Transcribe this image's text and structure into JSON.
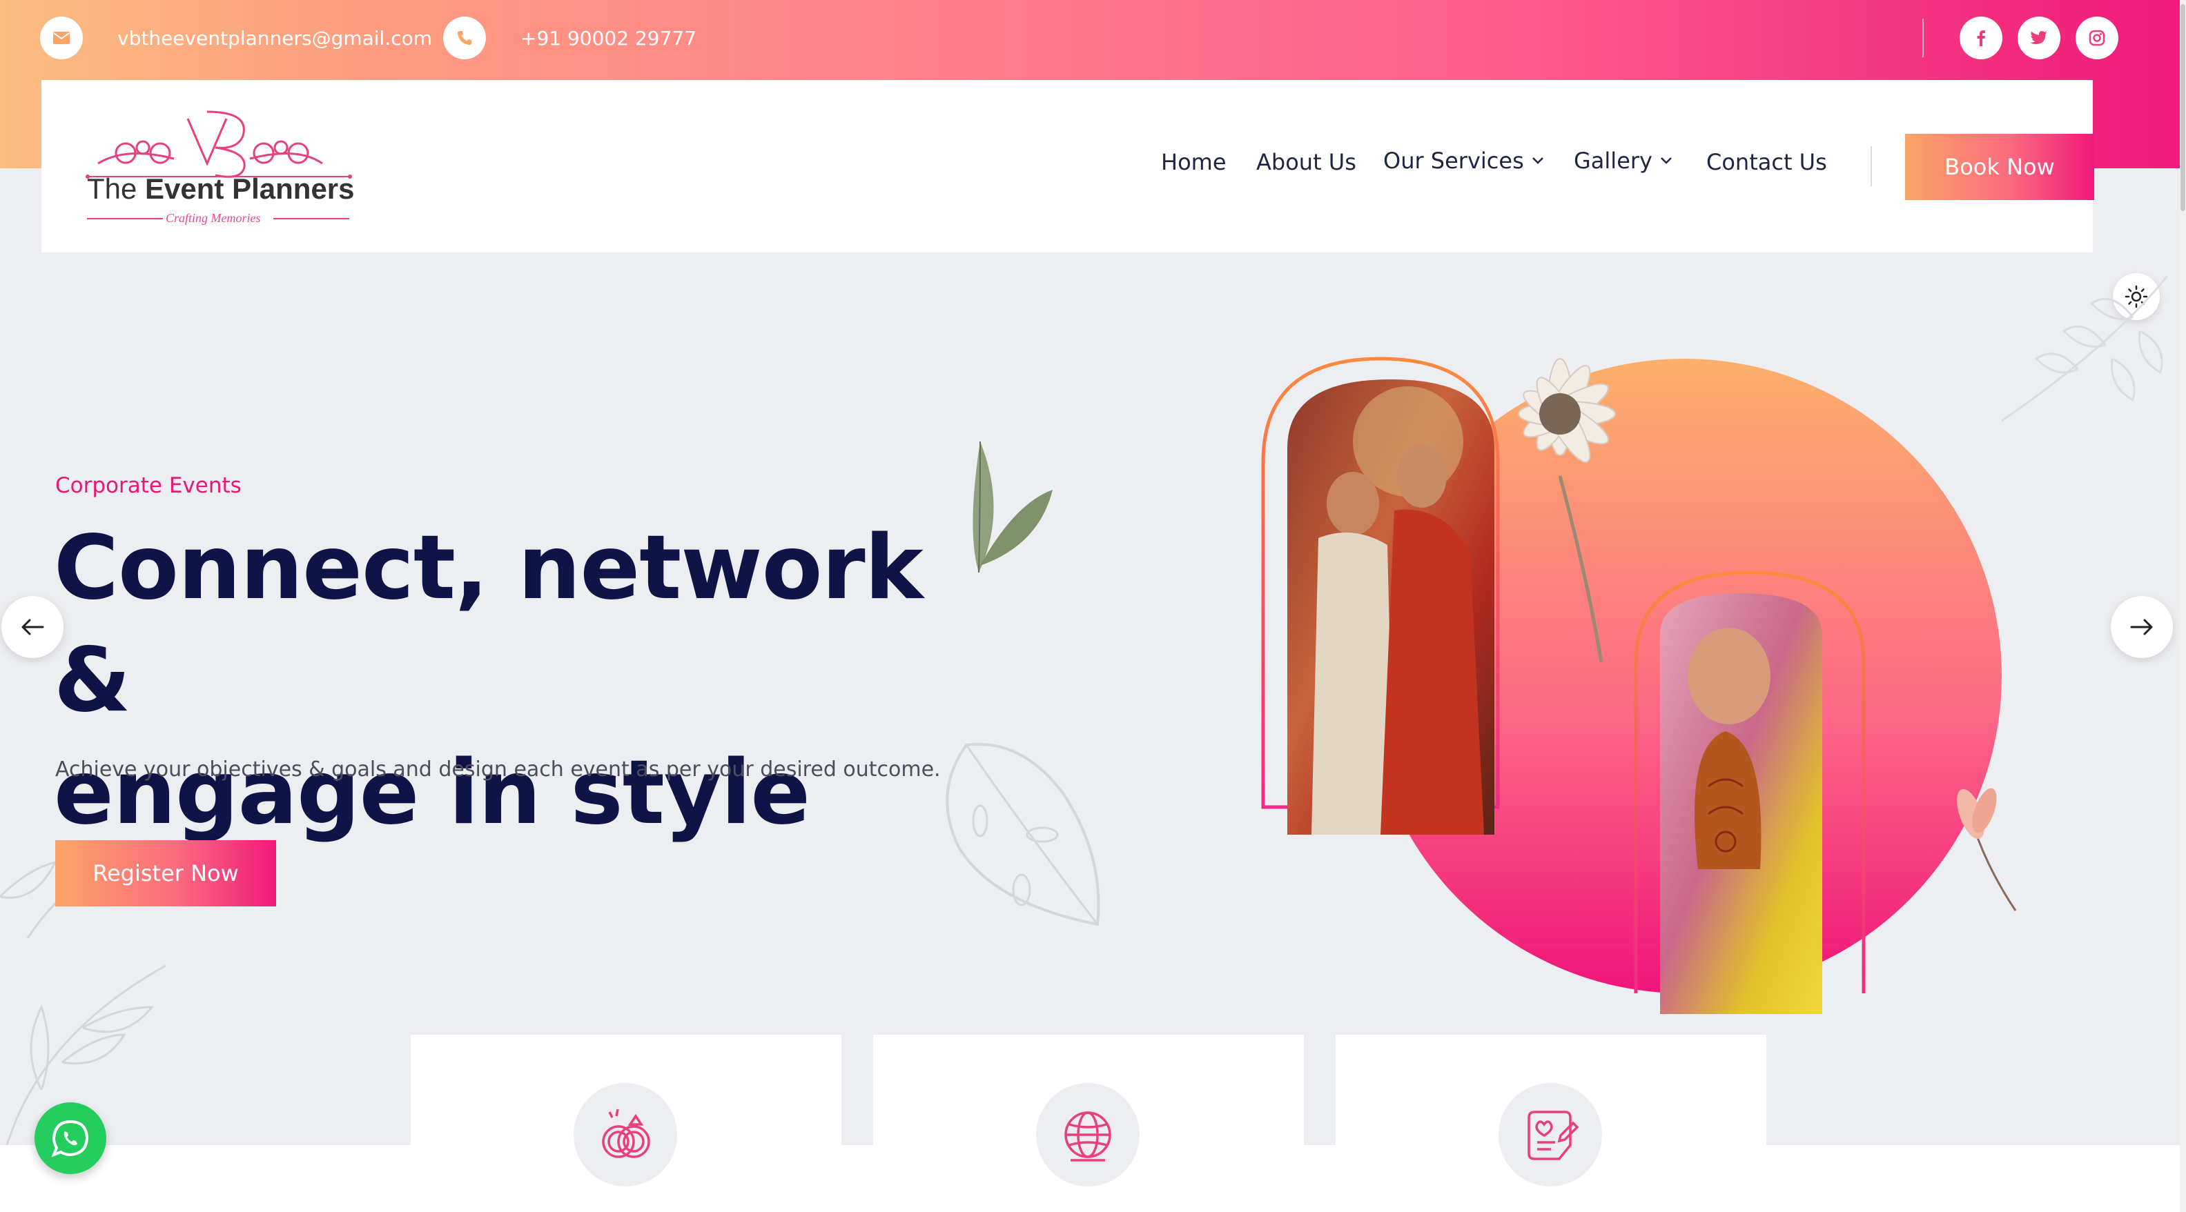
{
  "topbar": {
    "email": "vbtheeventplanners@gmail.com",
    "phone": "+91 90002 29777",
    "email_icon": "mail-icon",
    "phone_icon": "phone-icon",
    "socials": [
      "facebook-icon",
      "twitter-icon",
      "instagram-icon"
    ]
  },
  "logo": {
    "monogram": "VB",
    "name_light": "The",
    "name_bold": "Event Planners",
    "tagline": "Crafting Memories"
  },
  "nav": {
    "items": [
      {
        "label": "Home"
      },
      {
        "label": "About Us"
      },
      {
        "label": "Our Services"
      },
      {
        "label": "Gallery"
      },
      {
        "label": "Contact Us"
      }
    ],
    "book_label": "Book Now"
  },
  "hero": {
    "subtitle": "Corporate Events",
    "title_line1": "Connect, network &",
    "title_line2": "engage in style",
    "description": "Achieve your objectives & goals and design each event as per your desired outcome.",
    "cta": "Register Now"
  },
  "features": [
    {
      "icon": "rings-icon"
    },
    {
      "icon": "globe-icon"
    },
    {
      "icon": "document-heart-icon"
    }
  ],
  "colors": {
    "accent_pink": "#e81873",
    "accent_orange": "#fba466",
    "title_navy": "#0f1447",
    "whatsapp_green": "#25cd5e"
  }
}
